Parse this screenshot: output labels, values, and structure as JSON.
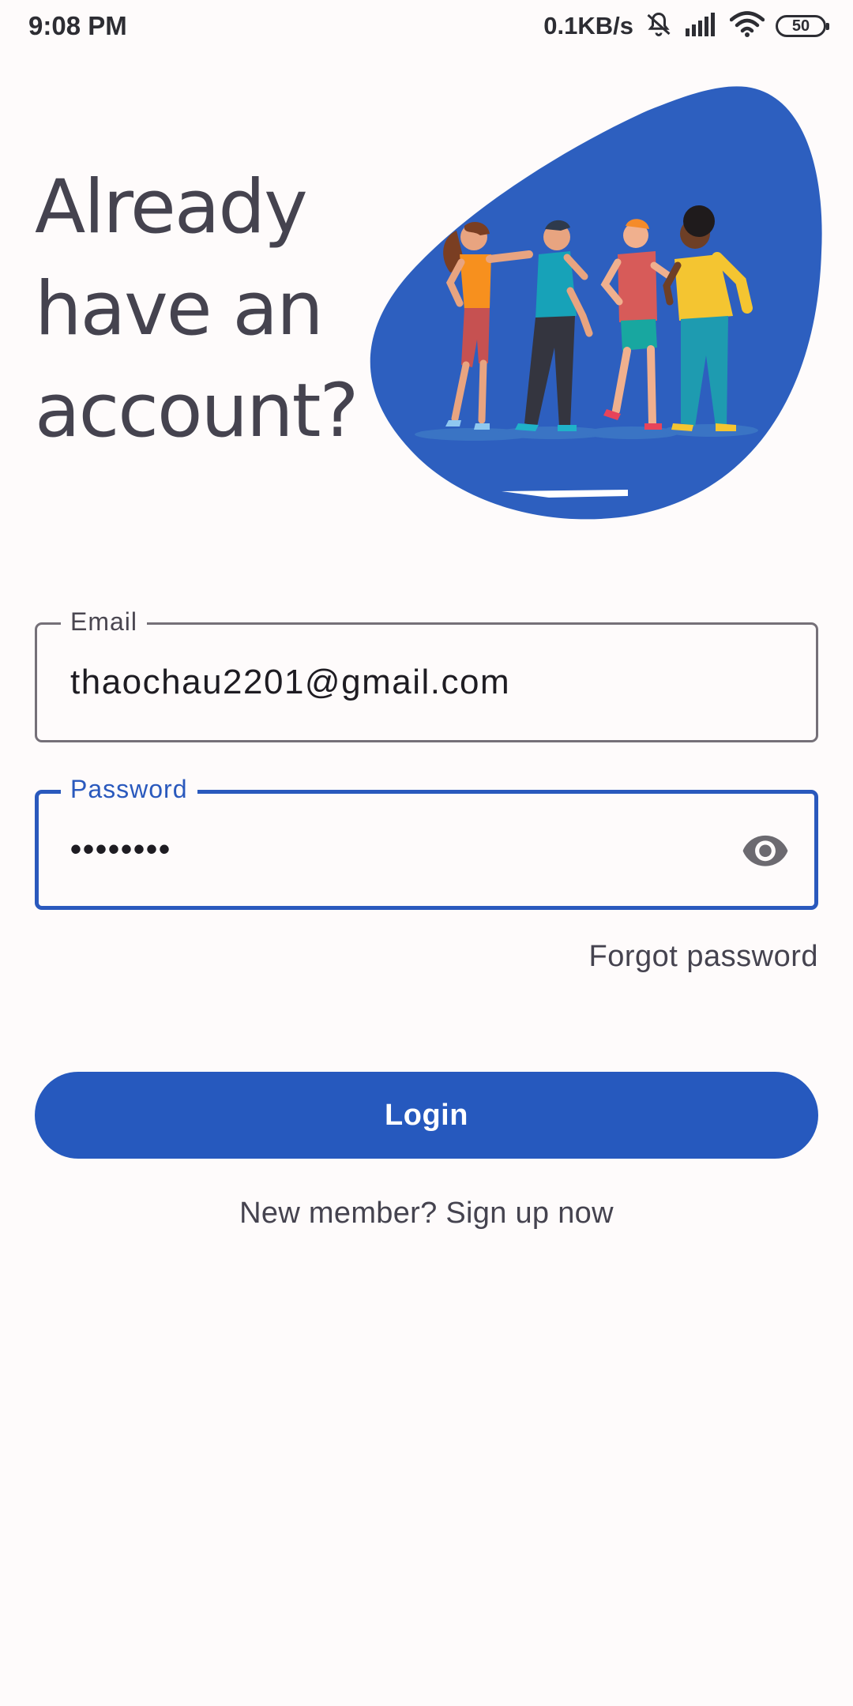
{
  "status_bar": {
    "time": "9:08 PM",
    "net_speed": "0.1KB/s",
    "battery": "50",
    "icons": [
      "bell-muted-icon",
      "signal-icon",
      "wifi-icon",
      "battery-icon"
    ]
  },
  "header": {
    "title": "Already have an account?",
    "illustration": "group-of-friends-illustration"
  },
  "form": {
    "email": {
      "label": "Email",
      "value": "thaochau2201@gmail.com"
    },
    "password": {
      "label": "Password",
      "value": "••••••••",
      "toggle_icon": "eye-icon"
    },
    "forgot_label": "Forgot password",
    "login_label": "Login",
    "signup_label": "New member? Sign up now"
  },
  "colors": {
    "primary": "#2659be",
    "focused_border": "#2a59bd",
    "text_dark": "#45434f",
    "background": "#fefbfb",
    "blob": "#2d5fbf"
  }
}
